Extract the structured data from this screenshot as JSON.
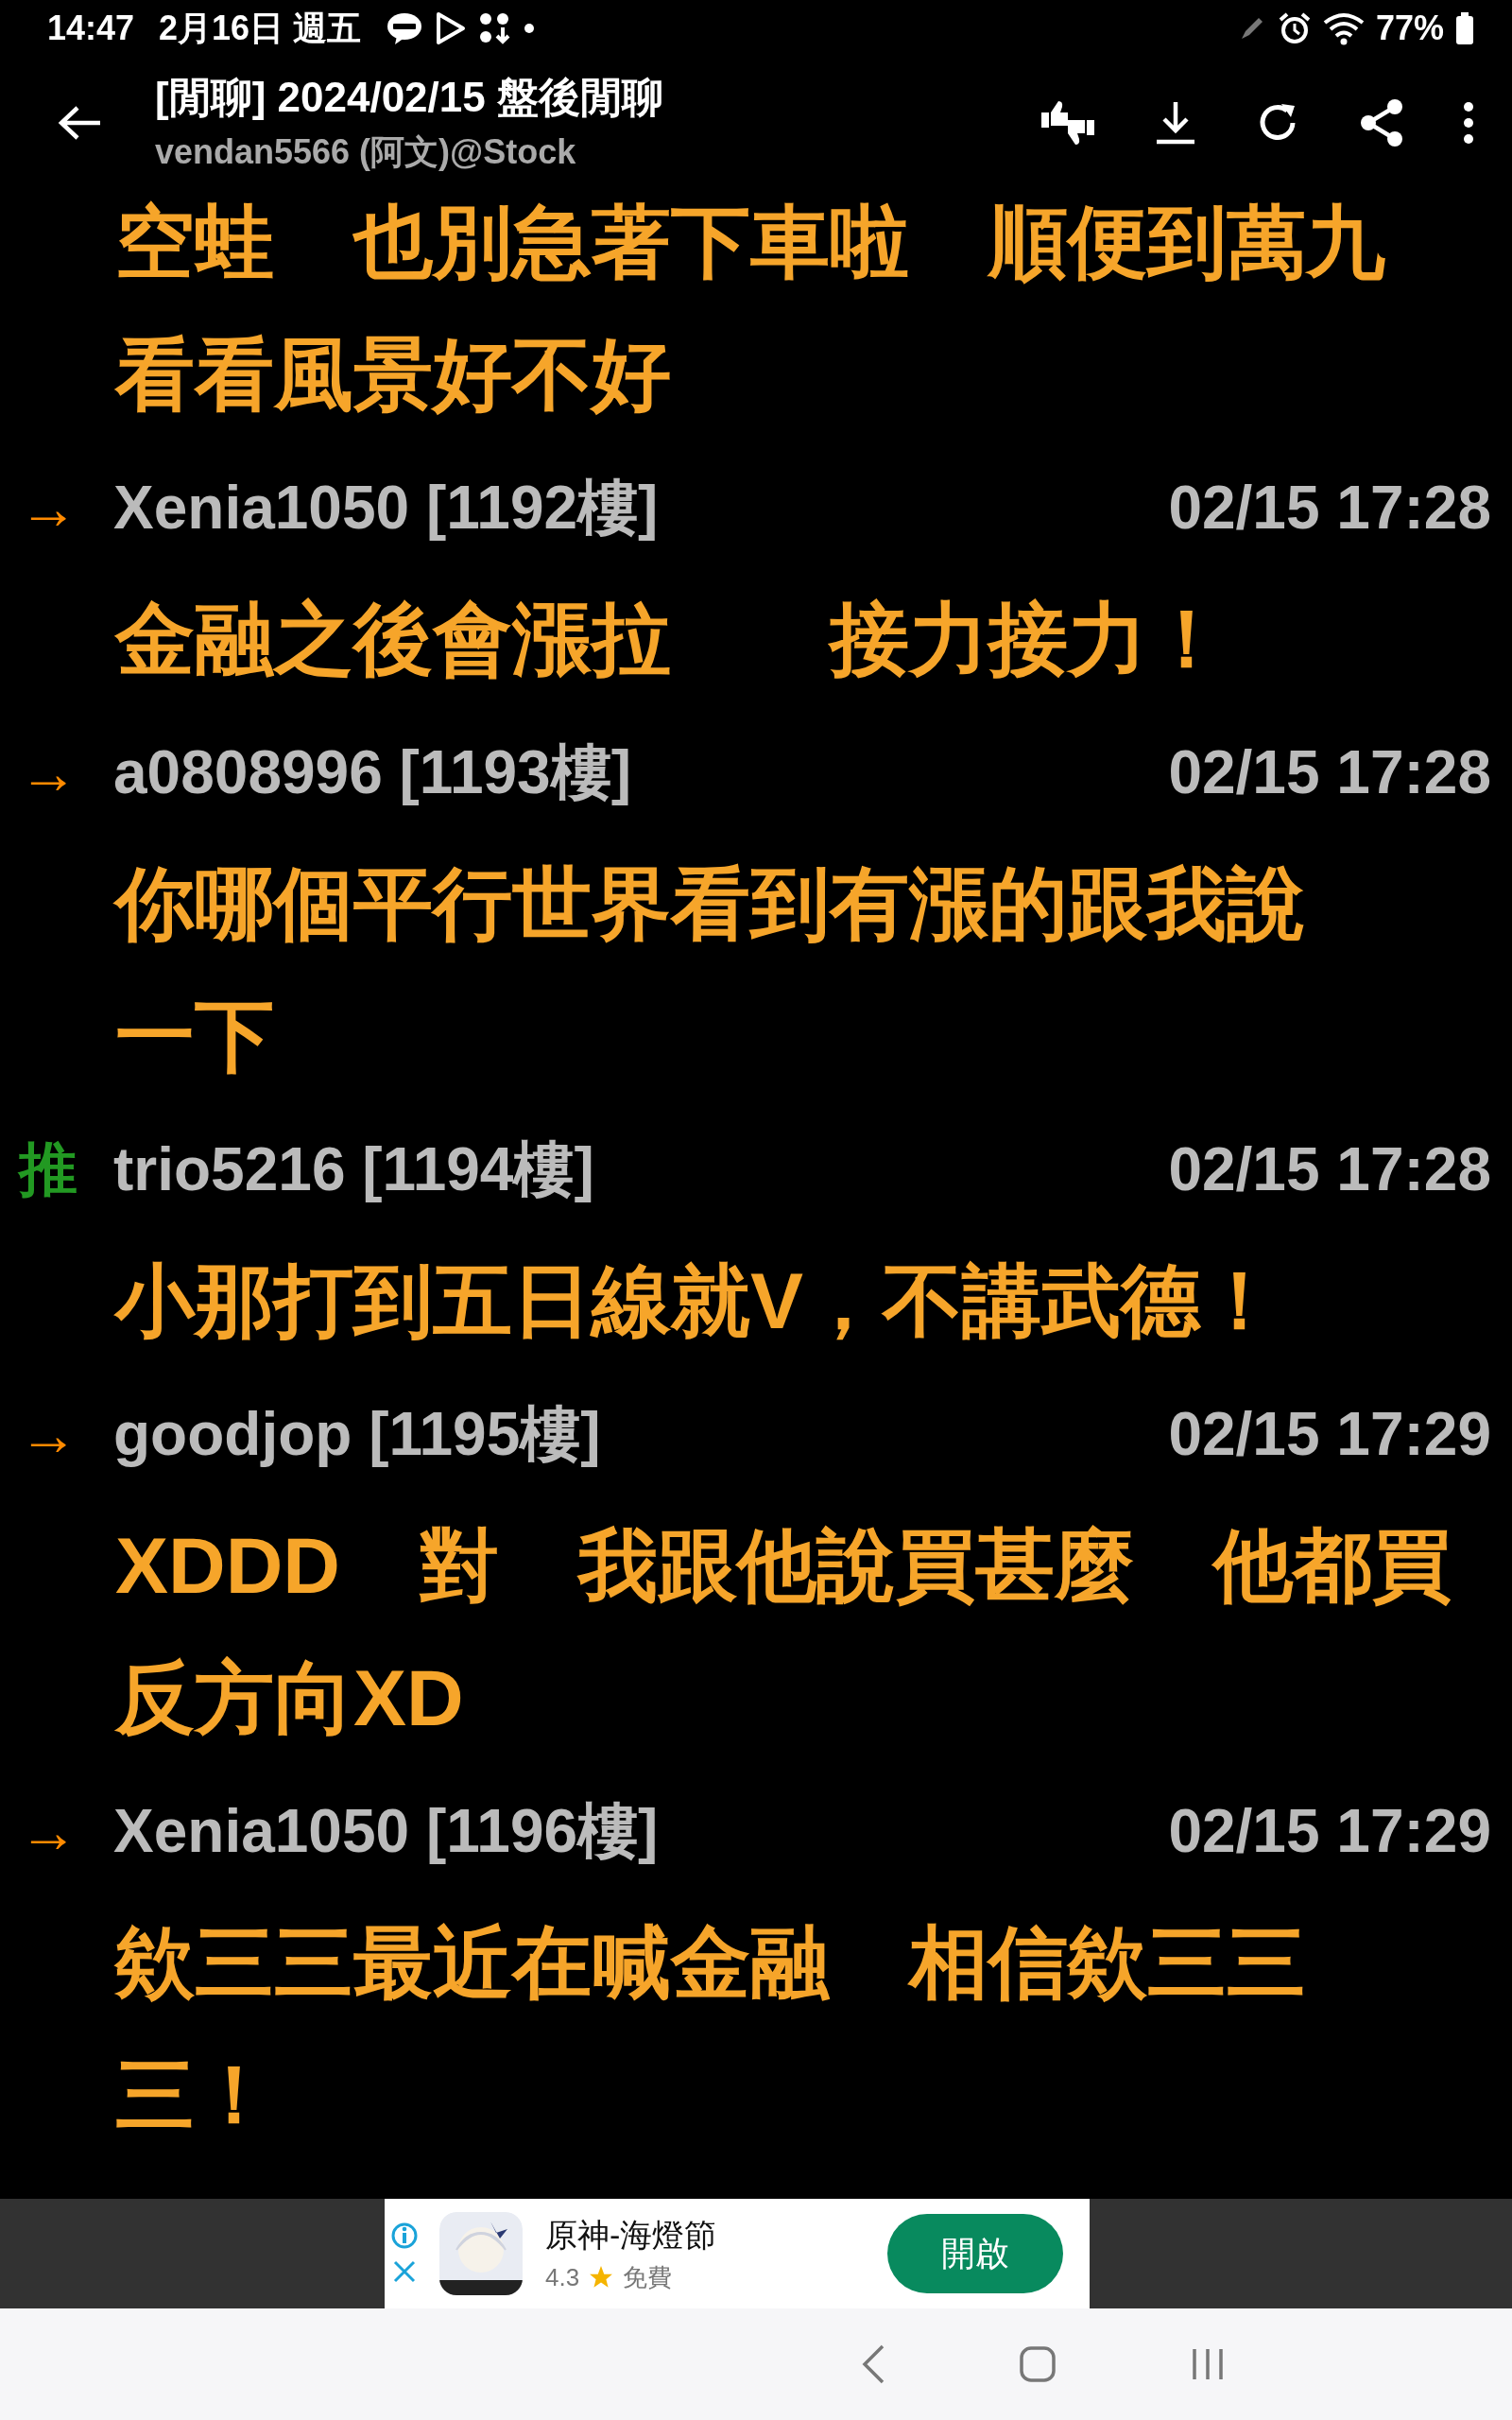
{
  "status_bar": {
    "time": "14:47",
    "date": "2月16日 週五",
    "battery": "77%"
  },
  "header": {
    "title": "[閒聊] 2024/02/15 盤後閒聊",
    "subtitle": "vendan5566 (阿文)@Stock"
  },
  "comments": [
    {
      "lines": [
        "空蛙　也別急著下車啦　順便到萬九",
        "看看風景好不好"
      ]
    },
    {
      "tag": "→",
      "color": "#ff8a00",
      "author": "Xenia1050 [1192樓]",
      "time": "02/15 17:28",
      "lines": [
        "金融之後會漲拉　　接力接力！"
      ]
    },
    {
      "tag": "→",
      "color": "#ff8a00",
      "author": "a0808996 [1193樓]",
      "time": "02/15 17:28",
      "lines": [
        "你哪個平行世界看到有漲的跟我說",
        "一下"
      ]
    },
    {
      "tag": "推",
      "color": "#229922",
      "author": "trio5216 [1194樓]",
      "time": "02/15 17:28",
      "lines": [
        "小那打到五日線就V，不講武德！"
      ]
    },
    {
      "tag": "→",
      "color": "#ff8a00",
      "author": "goodjop [1195樓]",
      "time": "02/15 17:29",
      "lines": [
        "XDDD　對　我跟他說買甚麼　他都買",
        "反方向XD"
      ]
    },
    {
      "tag": "→",
      "color": "#ff8a00",
      "author": "Xenia1050 [1196樓]",
      "time": "02/15 17:29",
      "lines": [
        "欸三三最近在喊金融　相信欸三三",
        "三！"
      ]
    }
  ],
  "ad": {
    "app_name": "原神-海燈節",
    "rating": "4.3",
    "price": "免費",
    "button": "開啟"
  }
}
